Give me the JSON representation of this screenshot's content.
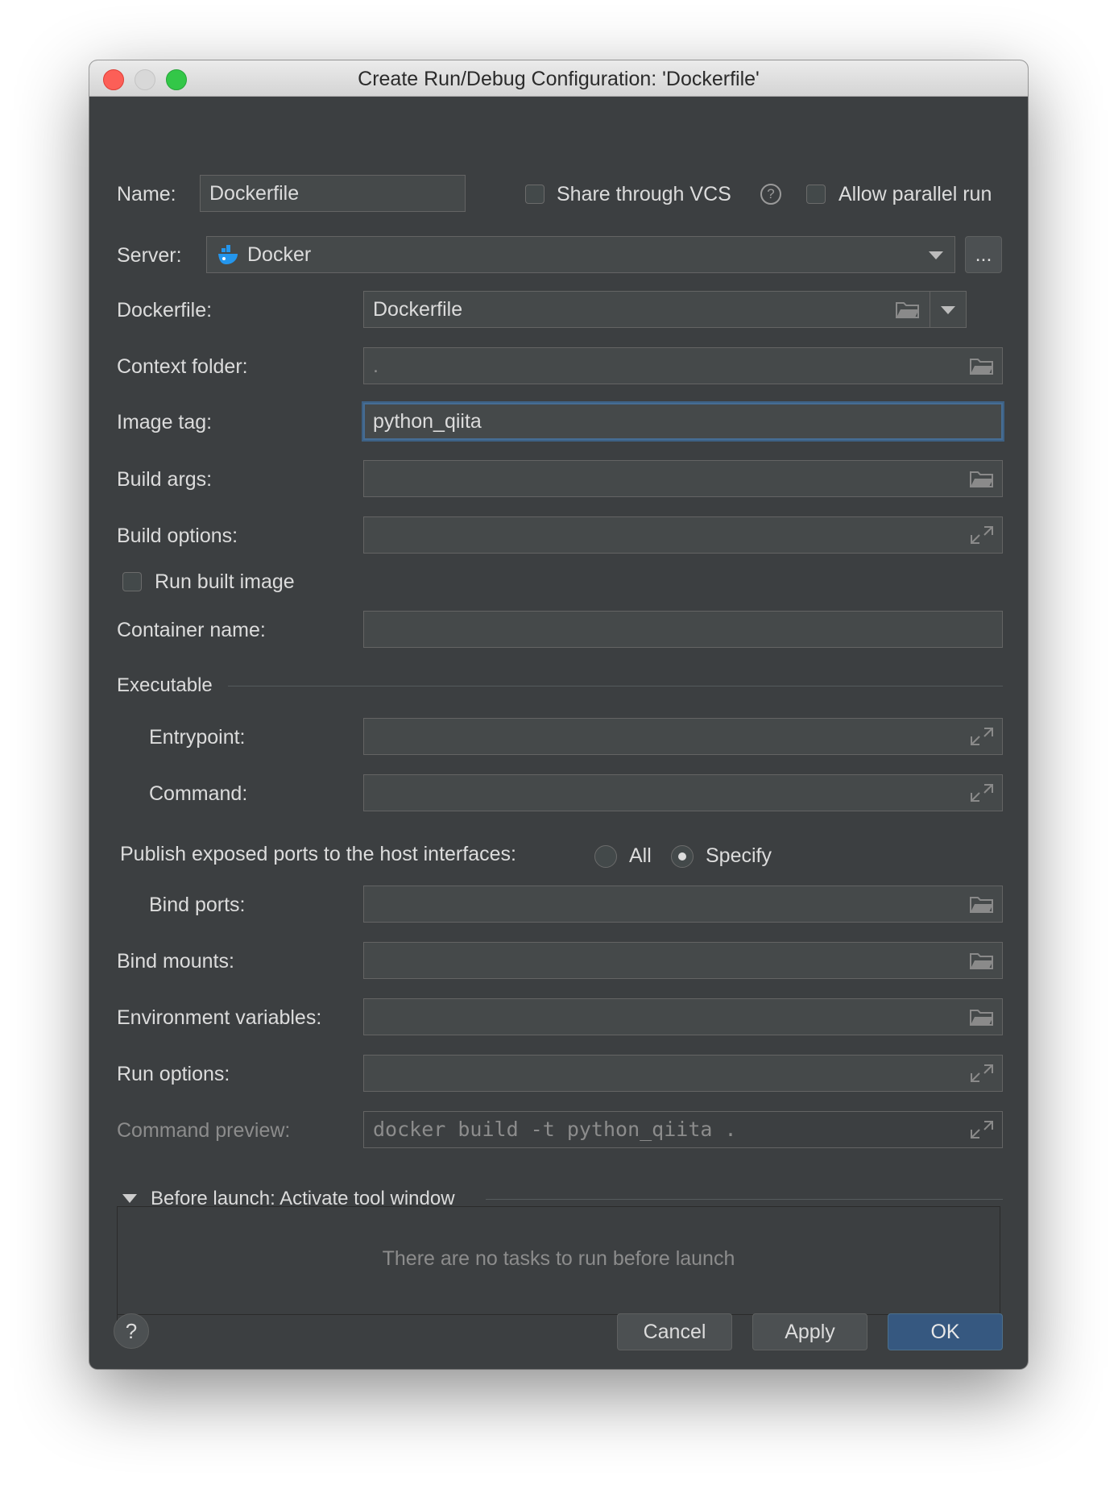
{
  "window": {
    "title": "Create Run/Debug Configuration: 'Dockerfile'"
  },
  "name_row": {
    "label": "Name:",
    "value": "Dockerfile",
    "share_vcs": {
      "label": "Share through VCS",
      "checked": false
    },
    "allow_parallel": {
      "label": "Allow parallel run",
      "checked": false
    }
  },
  "server": {
    "label": "Server:",
    "value": "Docker",
    "more_label": "..."
  },
  "dockerfile": {
    "label": "Dockerfile:",
    "value": "Dockerfile"
  },
  "context_folder": {
    "label": "Context folder:",
    "value": "."
  },
  "image_tag": {
    "label": "Image tag:",
    "value": "python_qiita"
  },
  "build_args": {
    "label": "Build args:",
    "value": ""
  },
  "build_options": {
    "label": "Build options:",
    "value": ""
  },
  "run_built_image": {
    "label": "Run built image",
    "checked": false
  },
  "container_name": {
    "label": "Container name:",
    "value": ""
  },
  "executable": {
    "title": "Executable",
    "entrypoint": {
      "label": "Entrypoint:",
      "value": ""
    },
    "command": {
      "label": "Command:",
      "value": ""
    }
  },
  "publish_ports": {
    "label": "Publish exposed ports to the host interfaces:",
    "options": [
      "All",
      "Specify"
    ],
    "selected": "Specify"
  },
  "bind_ports": {
    "label": "Bind ports:",
    "value": ""
  },
  "bind_mounts": {
    "label": "Bind mounts:",
    "value": ""
  },
  "env_vars": {
    "label": "Environment variables:",
    "value": ""
  },
  "run_options": {
    "label": "Run options:",
    "value": ""
  },
  "command_preview": {
    "label": "Command preview:",
    "value": "docker build -t python_qiita ."
  },
  "before_launch": {
    "title": "Before launch: Activate tool window",
    "empty_text": "There are no tasks to run before launch"
  },
  "buttons": {
    "help": "?",
    "cancel": "Cancel",
    "apply": "Apply",
    "ok": "OK"
  },
  "colors": {
    "background": "#3c3f41",
    "field": "#45494a",
    "focus": "#466d94",
    "primary_button": "#365880",
    "docker_blue": "#2496ed"
  },
  "icons": {
    "folder": "folder-icon",
    "expand": "expand-icon",
    "dropdown": "chevron-down-icon",
    "docker": "docker-icon",
    "help": "help-icon"
  }
}
